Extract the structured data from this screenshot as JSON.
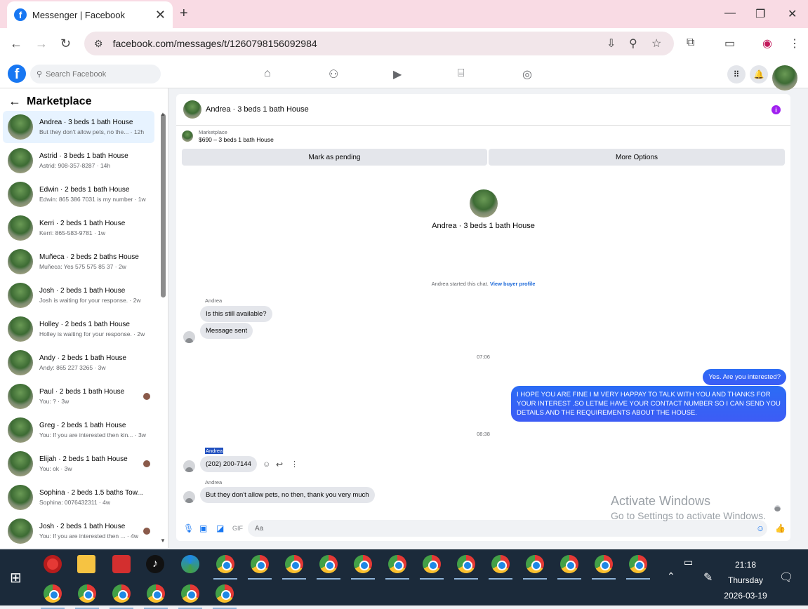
{
  "browser": {
    "tab_title": "Messenger | Facebook",
    "url": "facebook.com/messages/t/1260798156092984"
  },
  "fb": {
    "logo": "f",
    "search_placeholder": "Search Facebook"
  },
  "sidebar": {
    "title": "Marketplace",
    "conversations": [
      {
        "name": "Andrea · 3 beds 1 bath House",
        "preview": "But they don't allow pets, no the... · 12h",
        "active": true
      },
      {
        "name": "Astrid · 3 beds 1 bath House",
        "preview": "Astrid: 908-357-8287 · 14h"
      },
      {
        "name": "Edwin · 2 beds 1 bath House",
        "preview": "Edwin: 865 386 7031 is my number · 1w"
      },
      {
        "name": "Kerri · 2 beds 1 bath House",
        "preview": "Kerri: 865-583-9781 · 1w"
      },
      {
        "name": "Muñeca · 2 beds 2 baths House",
        "preview": "Muñeca: Yes 575 575 85 37 · 2w"
      },
      {
        "name": "Josh · 2 beds 1 bath House",
        "preview": "Josh is waiting for your response. · 2w"
      },
      {
        "name": "Holley · 2 beds 1 bath House",
        "preview": "Holley is waiting for your response. · 2w"
      },
      {
        "name": "Andy · 2 beds 1 bath House",
        "preview": "Andy: 865 227 3265 · 3w"
      },
      {
        "name": "Paul · 2 beds 1 bath House",
        "preview": "You: ? · 3w"
      },
      {
        "name": "Greg · 2 beds 1 bath House",
        "preview": "You: If you are interested then kin... · 3w"
      },
      {
        "name": "Elijah · 2 beds 1 bath House",
        "preview": "You: ok · 3w"
      },
      {
        "name": "Sophina · 2 beds 1.5 baths Tow...",
        "preview": "Sophina: 0076432311 · 4w"
      },
      {
        "name": "Josh · 2 beds 1 bath House",
        "preview": "You: If you are interested then ... · 4w"
      }
    ]
  },
  "chat": {
    "title": "Andrea · 3 beds 1 bath House",
    "marketplace_label": "Marketplace",
    "listing": "$690 – 3 beds 1 bath House",
    "mark_pending": "Mark as pending",
    "more_options": "More Options",
    "profile_name": "Andrea · 3 beds 1 bath House",
    "started_text": "Andrea started this chat.",
    "view_profile": "View buyer profile",
    "sender": "Andrea",
    "msg1": "Is this still available?",
    "msg2": "Message sent",
    "time1": "07:06",
    "out1": "Yes. Are you interested?",
    "out2": "I HOPE YOU ARE FINE I M VERY HAPPAY TO TALK WITH YOU AND THANKS FOR YOUR INTEREST .SO LETME HAVE YOUR CONTACT NUMBER SO I CAN SEND YOU DETAILS AND THE REQUIREMENTS ABOUT THE HOUSE.",
    "time2": "08:38",
    "msg3": "(202) 200-7144",
    "msg4": "But they don't allow pets, no then, thank you very much",
    "composer_placeholder": "Aa"
  },
  "watermark": {
    "line1": "Activate Windows",
    "line2": "Go to Settings to activate Windows."
  },
  "taskbar": {
    "time": "21:18",
    "day": "Thursday",
    "date": "2026-03-19"
  }
}
